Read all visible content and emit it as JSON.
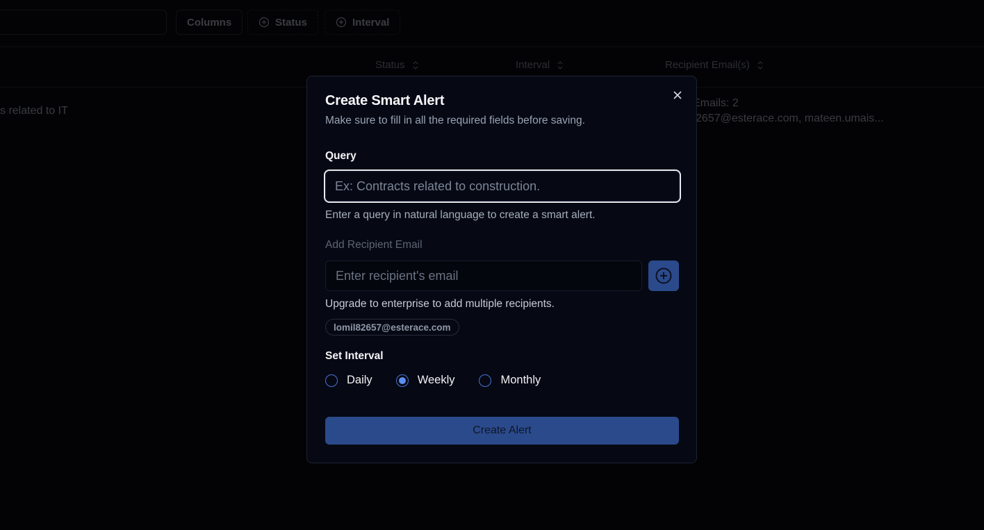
{
  "background": {
    "toolbar": {
      "columns_label": "Columns",
      "status_filter_label": "Status",
      "interval_filter_label": "Interval"
    },
    "table": {
      "columns": [
        {
          "label": "Status",
          "icon": "sort-icon"
        },
        {
          "label": "Interval",
          "icon": "sort-icon"
        },
        {
          "label": "Recipient Email(s)",
          "icon": "sort-icon"
        }
      ],
      "rows": [
        {
          "query_fragment": "s related to IT",
          "emails_count": "Emails: 2",
          "emails_list": "2657@esterace.com, mateen.umais..."
        }
      ]
    }
  },
  "modal": {
    "title": "Create Smart Alert",
    "subtitle": "Make sure to fill in all the required fields before saving.",
    "close_icon": "close-icon",
    "query": {
      "label": "Query",
      "value": "",
      "placeholder": "Ex: Contracts related to construction.",
      "help": "Enter a query in natural language to create a smart alert."
    },
    "recipient": {
      "label": "Add Recipient Email",
      "value": "",
      "placeholder": "Enter recipient's email",
      "add_icon": "plus-circle-icon",
      "help": "Upgrade to enterprise to add multiple recipients.",
      "chips": [
        "lomil82657@esterace.com"
      ]
    },
    "interval": {
      "label": "Set Interval",
      "options": [
        "Daily",
        "Weekly",
        "Monthly"
      ],
      "selected": "Weekly"
    },
    "submit_label": "Create Alert",
    "colors": {
      "accent": "#2b4a8c",
      "radio": "#5b8ff0",
      "modal_bg": "#060914"
    }
  }
}
